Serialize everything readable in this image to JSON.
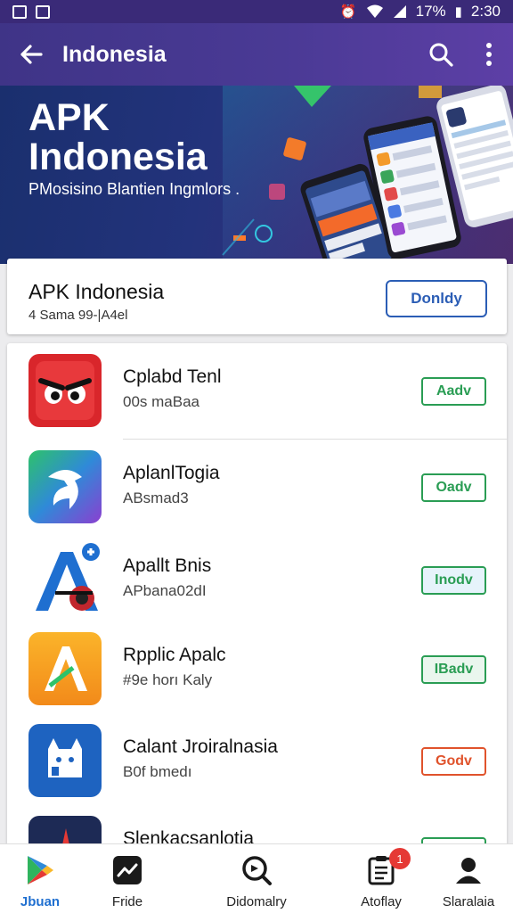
{
  "status_bar": {
    "time": "2:30",
    "battery": "17%",
    "icons": [
      "image-icon",
      "gallery-icon",
      "alarm-icon",
      "wifi-icon",
      "signal-icon",
      "battery-icon"
    ]
  },
  "app_bar": {
    "title": "Indonesia",
    "back_icon": "arrow-left-icon",
    "search_icon": "search-icon",
    "more_icon": "more-vert-icon"
  },
  "banner": {
    "title": "APK Indonesia",
    "subtitle": "PMosisino Blantien Ingmlors ."
  },
  "feature": {
    "title": "APK Indonesia",
    "meta": "4 Sama 99-|A4el",
    "button_label": "Donldy"
  },
  "apps": [
    {
      "name": "Cplabd Tenl",
      "sub": "00s maBaa",
      "button": "Aadv",
      "button_color": "#2a9d54"
    },
    {
      "name": "AplanlTogia",
      "sub": "ABsmad3",
      "button": "Oadv",
      "button_color": "#2a9d54"
    },
    {
      "name": "Apallt Bnis",
      "sub": "APbana02dI",
      "button": "Inodv",
      "button_color": "#2f7fb8"
    },
    {
      "name": "Rpplic Apalc",
      "sub": "#9e horı Kaly",
      "button": "IBadv",
      "button_color": "#2a9d54"
    },
    {
      "name": "Calant Jroiralnasia",
      "sub": "B0f bmedı",
      "button": "Godv",
      "button_color": "#e0532c"
    },
    {
      "name": "Slenkacsanlotia",
      "sub": "",
      "button": "",
      "button_color": "#2a9d54"
    }
  ],
  "bottom_nav": [
    {
      "label": "Jbuan",
      "icon": "play-store-icon",
      "active": true
    },
    {
      "label": "Fride",
      "icon": "trending-icon"
    },
    {
      "label": "Didomalry",
      "icon": "discover-icon"
    },
    {
      "label": "Atoflay",
      "icon": "library-icon",
      "badge": "1"
    },
    {
      "label": "Slaralaia",
      "icon": "profile-icon"
    }
  ],
  "colors": {
    "app_bar": "#433690",
    "accent_blue": "#2b5db5",
    "green": "#2a9d54",
    "badge_red": "#e53935"
  }
}
